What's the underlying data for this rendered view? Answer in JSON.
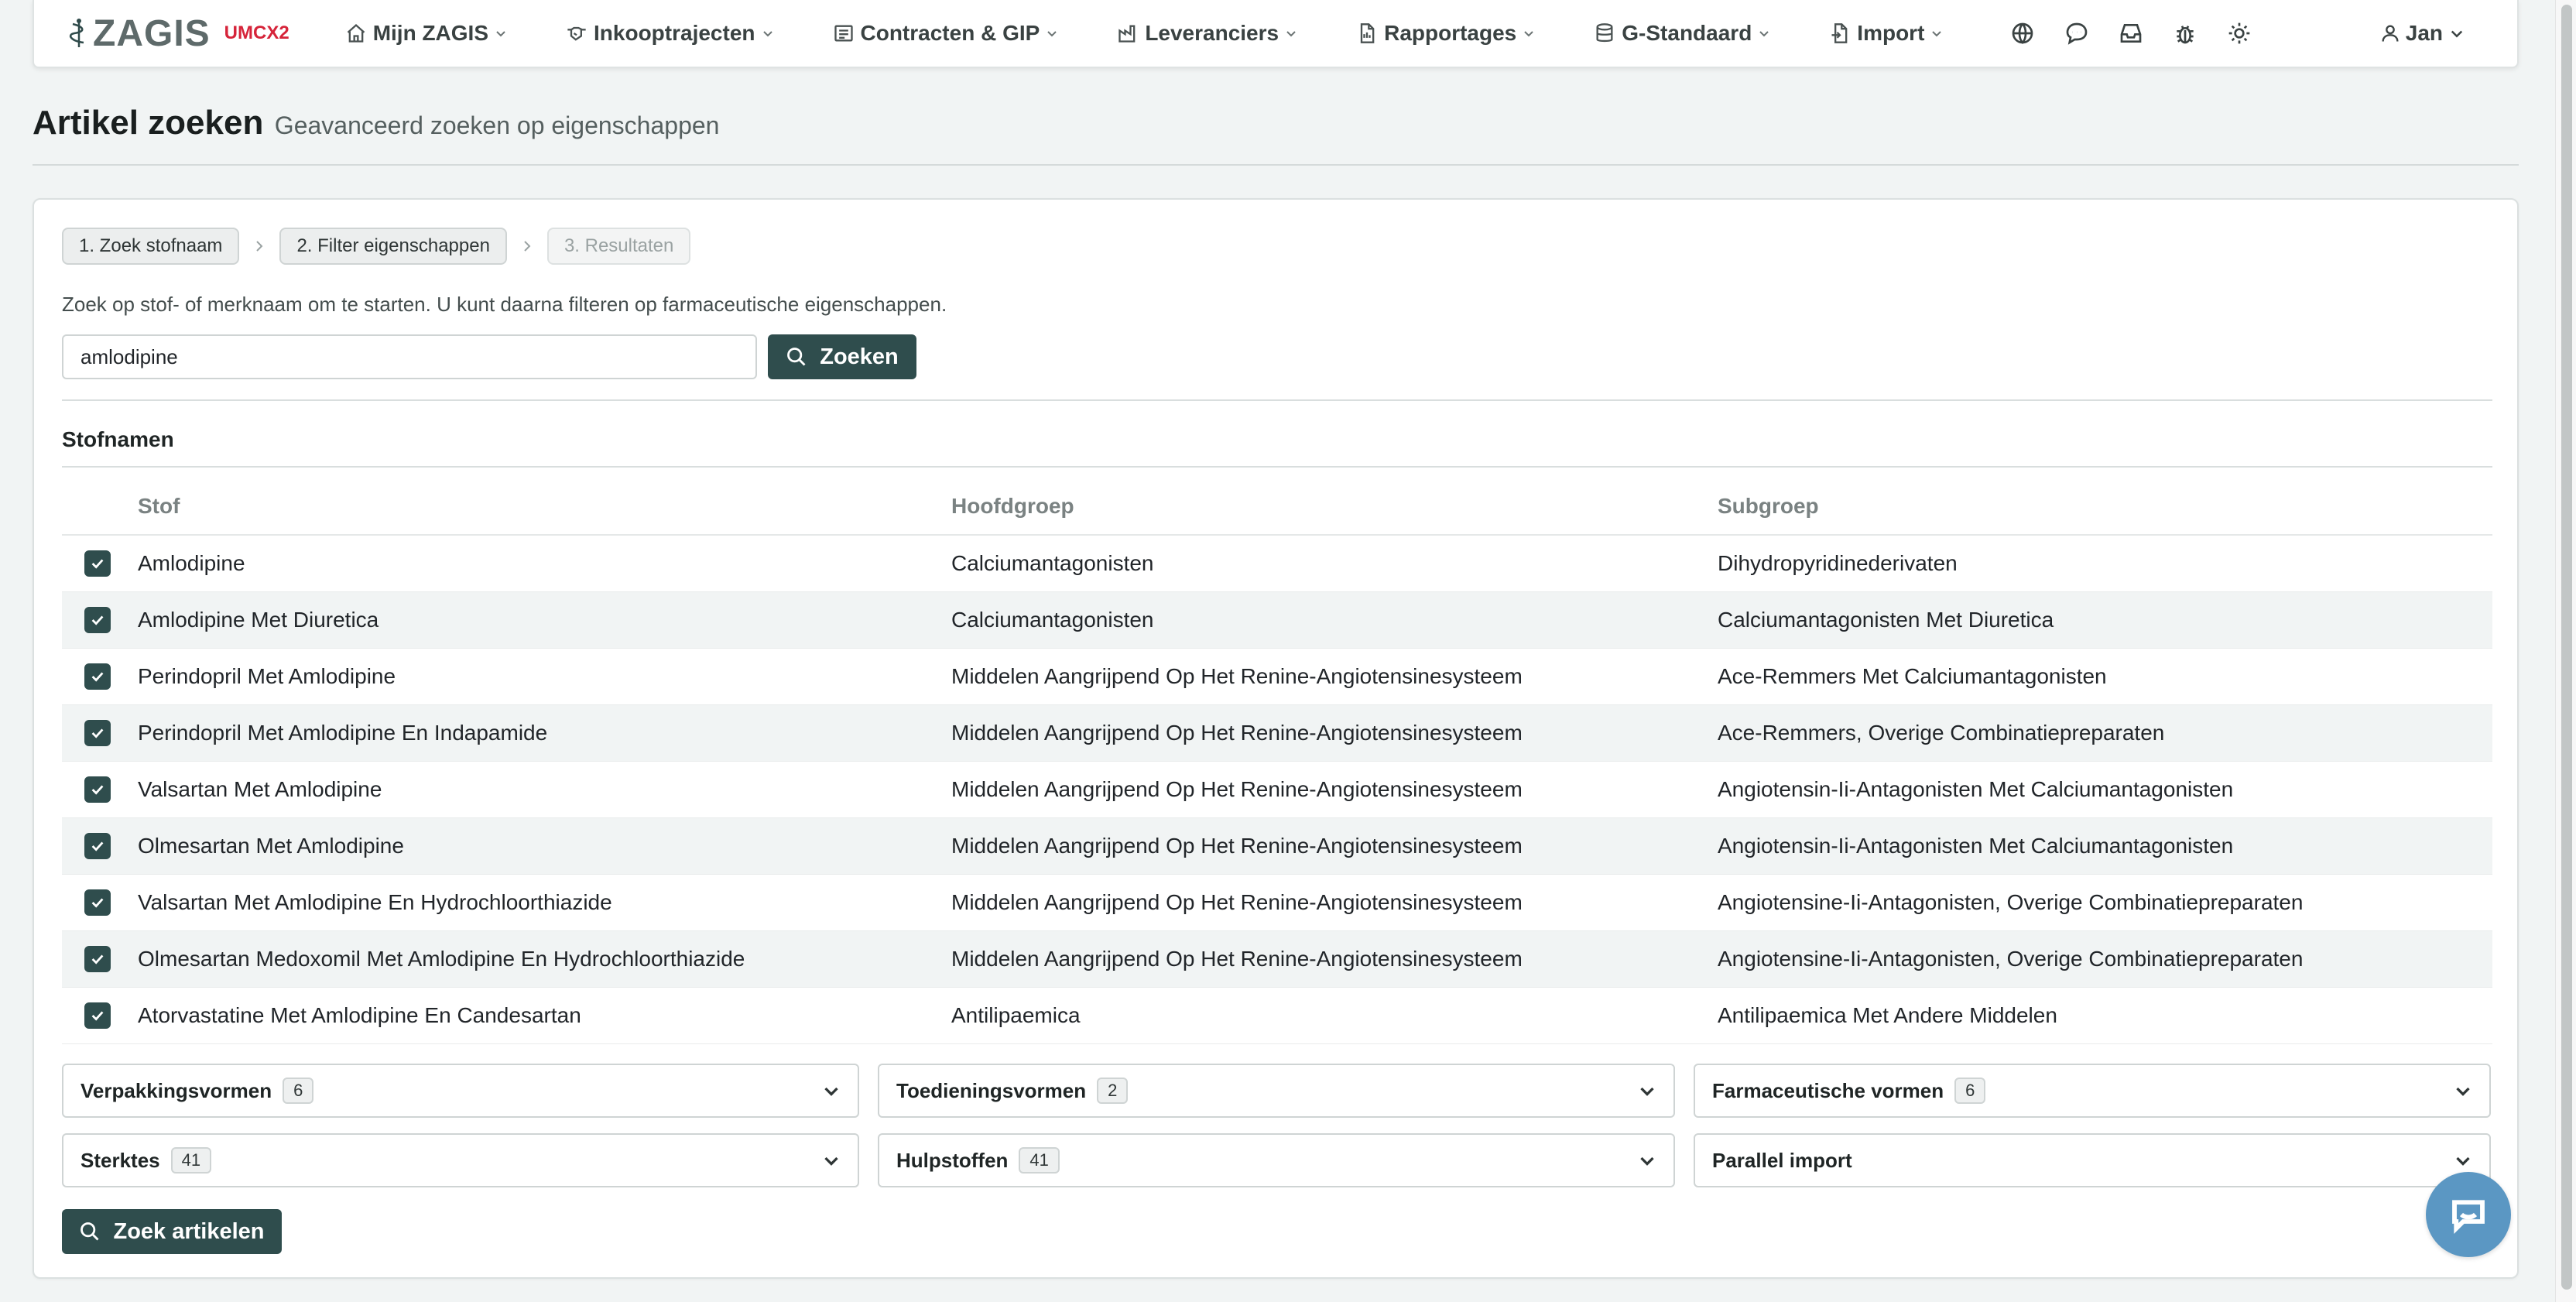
{
  "app": {
    "brand": "ZAGIS",
    "tenant": "UMCX2"
  },
  "nav": {
    "items": [
      {
        "label": "Mijn ZAGIS",
        "icon": "home-icon"
      },
      {
        "label": "Inkooptrajecten",
        "icon": "handshake-icon"
      },
      {
        "label": "Contracten & GIP",
        "icon": "list-icon"
      },
      {
        "label": "Leveranciers",
        "icon": "factory-icon"
      },
      {
        "label": "Rapportages",
        "icon": "report-icon"
      },
      {
        "label": "G-Standaard",
        "icon": "database-icon"
      },
      {
        "label": "Import",
        "icon": "file-import-icon"
      }
    ],
    "icons": [
      "globe-icon",
      "chat-icon",
      "inbox-icon",
      "bug-icon",
      "sun-icon"
    ],
    "user": "Jan"
  },
  "page": {
    "title": "Artikel zoeken",
    "subtitle": "Geavanceerd zoeken op eigenschappen"
  },
  "steps": [
    {
      "label": "1. Zoek stofnaam",
      "enabled": true
    },
    {
      "label": "2. Filter eigenschappen",
      "enabled": true
    },
    {
      "label": "3. Resultaten",
      "enabled": false
    }
  ],
  "search": {
    "intro": "Zoek op stof- of merknaam om te starten. U kunt daarna filteren op farmaceutische eigenschappen.",
    "value": "amlodipine",
    "button": "Zoeken"
  },
  "stofnamen": {
    "title": "Stofnamen",
    "columns": [
      "Stof",
      "Hoofdgroep",
      "Subgroep"
    ],
    "rows": [
      {
        "checked": true,
        "stof": "Amlodipine",
        "hoofdgroep": "Calciumantagonisten",
        "subgroep": "Dihydropyridinederivaten"
      },
      {
        "checked": true,
        "stof": "Amlodipine Met Diuretica",
        "hoofdgroep": "Calciumantagonisten",
        "subgroep": "Calciumantagonisten Met Diuretica"
      },
      {
        "checked": true,
        "stof": "Perindopril Met Amlodipine",
        "hoofdgroep": "Middelen Aangrijpend Op Het Renine-Angiotensinesysteem",
        "subgroep": "Ace-Remmers Met Calciumantagonisten"
      },
      {
        "checked": true,
        "stof": "Perindopril Met Amlodipine En Indapamide",
        "hoofdgroep": "Middelen Aangrijpend Op Het Renine-Angiotensinesysteem",
        "subgroep": "Ace-Remmers, Overige Combinatiepreparaten"
      },
      {
        "checked": true,
        "stof": "Valsartan Met Amlodipine",
        "hoofdgroep": "Middelen Aangrijpend Op Het Renine-Angiotensinesysteem",
        "subgroep": "Angiotensin-Ii-Antagonisten Met Calciumantagonisten"
      },
      {
        "checked": true,
        "stof": "Olmesartan Met Amlodipine",
        "hoofdgroep": "Middelen Aangrijpend Op Het Renine-Angiotensinesysteem",
        "subgroep": "Angiotensin-Ii-Antagonisten Met Calciumantagonisten"
      },
      {
        "checked": true,
        "stof": "Valsartan Met Amlodipine En Hydrochloorthiazide",
        "hoofdgroep": "Middelen Aangrijpend Op Het Renine-Angiotensinesysteem",
        "subgroep": "Angiotensine-Ii-Antagonisten, Overige Combinatiepreparaten"
      },
      {
        "checked": true,
        "stof": "Olmesartan Medoxomil Met Amlodipine En Hydrochloorthiazide",
        "hoofdgroep": "Middelen Aangrijpend Op Het Renine-Angiotensinesysteem",
        "subgroep": "Angiotensine-Ii-Antagonisten, Overige Combinatiepreparaten"
      },
      {
        "checked": true,
        "stof": "Atorvastatine Met Amlodipine En Candesartan",
        "hoofdgroep": "Antilipaemica",
        "subgroep": "Antilipaemica Met Andere Middelen"
      }
    ]
  },
  "filters": [
    {
      "label": "Verpakkingsvormen",
      "count": "6"
    },
    {
      "label": "Toedieningsvormen",
      "count": "2"
    },
    {
      "label": "Farmaceutische vormen",
      "count": "6"
    },
    {
      "label": "Sterktes",
      "count": "41"
    },
    {
      "label": "Hulpstoffen",
      "count": "41"
    },
    {
      "label": "Parallel import",
      "count": ""
    }
  ],
  "actions": {
    "search_articles": "Zoek artikelen"
  },
  "colors": {
    "primary": "#2f4d4d",
    "tenant": "#d6243a",
    "chat": "#5b97c3",
    "row_alt": "#f1f4f4"
  }
}
